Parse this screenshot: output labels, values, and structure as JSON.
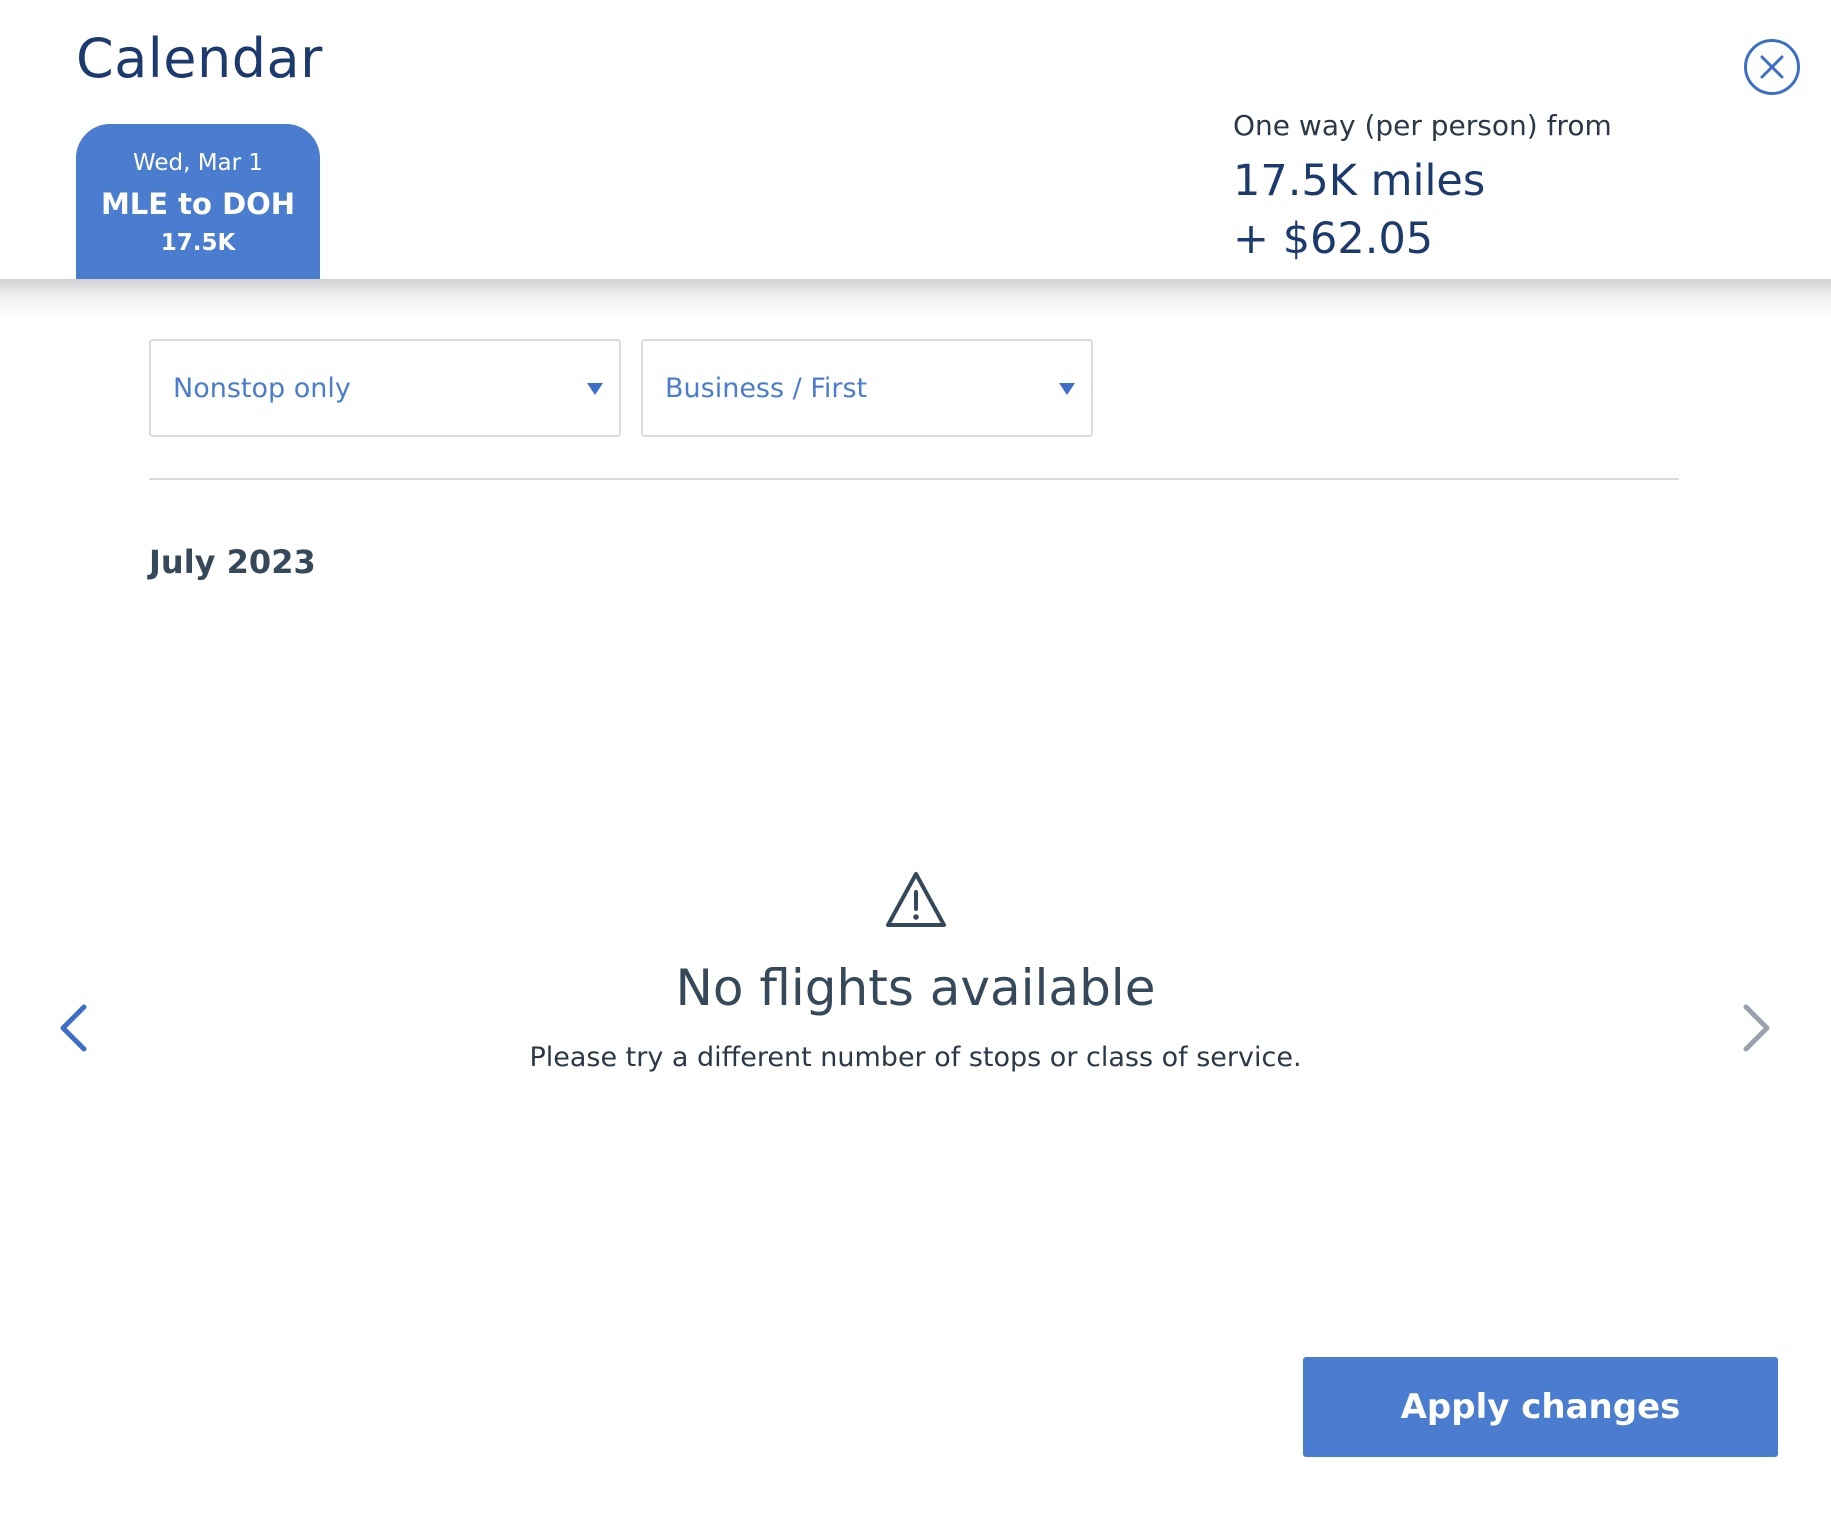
{
  "header": {
    "title": "Calendar",
    "close_icon": "close-circle-icon"
  },
  "date_tab": {
    "date": "Wed, Mar 1",
    "route": "MLE to DOH",
    "price": "17.5K"
  },
  "fare_summary": {
    "label": "One way (per person) from",
    "miles": "17.5K miles",
    "cash": "+ $62.05"
  },
  "filters": {
    "stops": {
      "selected": "Nonstop only"
    },
    "cabin": {
      "selected": "Business / First"
    }
  },
  "calendar": {
    "month": "July 2023",
    "prev_icon": "chevron-left-icon",
    "next_icon": "chevron-right-icon"
  },
  "empty_state": {
    "icon": "warning-icon",
    "title": "No flights available",
    "description": "Please try a different number of stops or class of service."
  },
  "actions": {
    "apply_label": "Apply changes"
  },
  "colors": {
    "accent": "#4a7cd0",
    "title": "#1c3a6e",
    "text": "#36495a",
    "border": "#d6dbe1",
    "next_arrow_disabled": "#9aa3ad"
  }
}
